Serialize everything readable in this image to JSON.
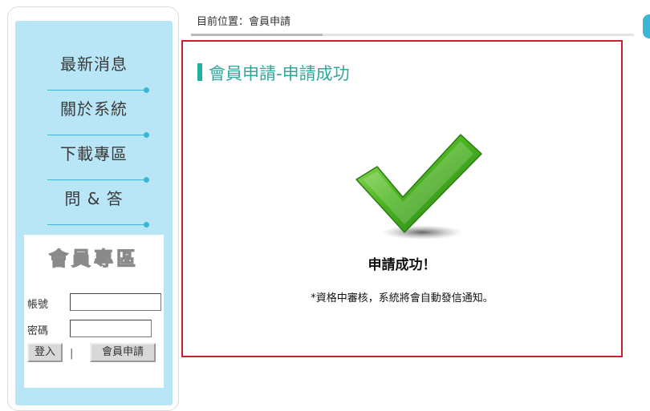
{
  "breadcrumb": {
    "text": "目前位置：會員申請"
  },
  "sidebar": {
    "nav": [
      {
        "label": "最新消息"
      },
      {
        "label": "關於系統"
      },
      {
        "label": "下載專區"
      },
      {
        "label": "問 & 答"
      }
    ],
    "member": {
      "title": "會員專區",
      "account_label": "帳號",
      "account_value": "",
      "password_label": "密碼",
      "password_value": "",
      "login_label": "登入",
      "separator": "|",
      "register_label": "會員申請"
    }
  },
  "content": {
    "heading": "會員申請-申請成功",
    "success_title": "申請成功！",
    "success_note": "*資格中審核，系統將會自動發信通知。",
    "icon": "checkmark-icon"
  },
  "colors": {
    "sidebar_bg": "#b9e6f6",
    "accent": "#3bb6d4",
    "heading": "#31a79c",
    "content_border": "#cc1f2a",
    "check_green": "#3fae1e"
  }
}
